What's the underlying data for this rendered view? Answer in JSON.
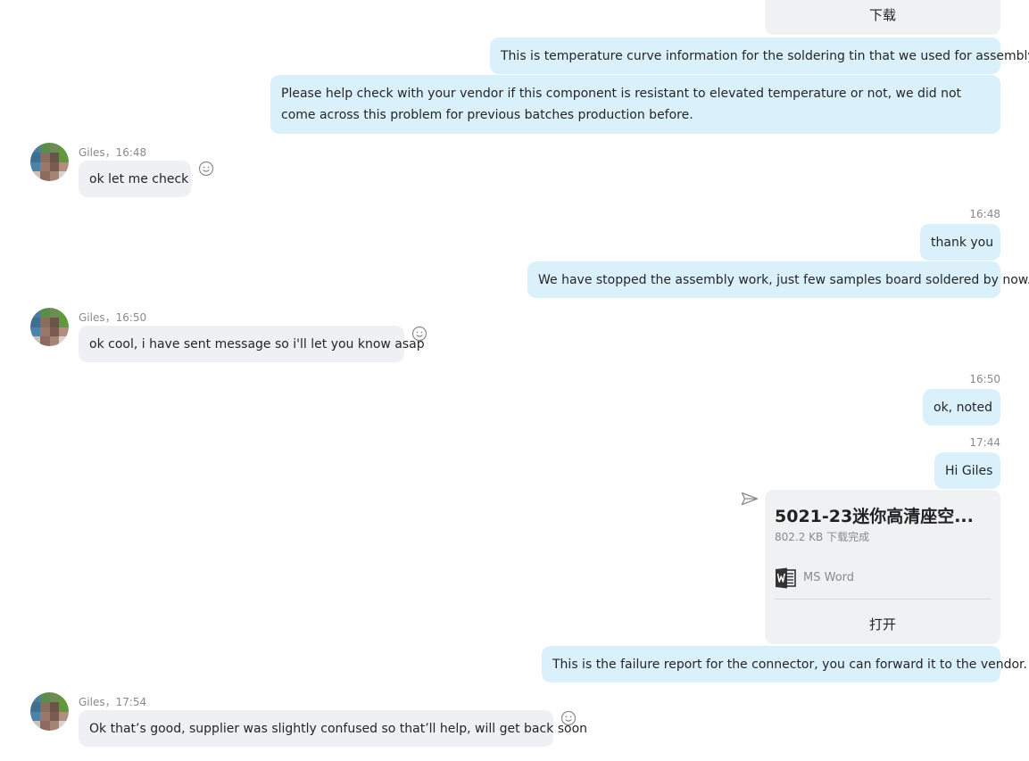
{
  "messages": {
    "top_card_download": "下载",
    "m1": "This is temperature curve information for the soldering tin that we used for assembly.",
    "m2": "Please help check with your vendor if this component is resistant to elevated temperature or not, we did not come across this problem for previous batches production before.",
    "g1_header": "Giles，16:48",
    "g1_text": "ok let me check",
    "t1": "16:48",
    "m3": "thank you",
    "m4": "We have stopped the assembly work, just few samples board soldered by now.",
    "g2_header": "Giles，16:50",
    "g2_text": "ok cool, i have sent message so i'll let you know asap",
    "t2": "16:50",
    "m5": "ok, noted",
    "t3": "17:44",
    "m6": "Hi Giles",
    "file": {
      "title": "5021-23迷你高清座空...",
      "size_status": "802.2 KB 下载完成",
      "app": "MS Word",
      "open_label": "打开"
    },
    "m7": "This is the failure report for the connector, you can forward it to the vendor.",
    "g3_header": "Giles，17:54",
    "g3_text": "Ok that’s good, supplier was slightly confused so that’ll help, will get back soon"
  },
  "colors": {
    "outgoing_bubble": "#daf1fb",
    "incoming_bubble": "#eef0f3",
    "timestamp": "#8a8a8a"
  },
  "icons": {
    "emoji": "smiley-icon",
    "sent": "paper-plane-icon",
    "word": "ms-word-icon"
  }
}
